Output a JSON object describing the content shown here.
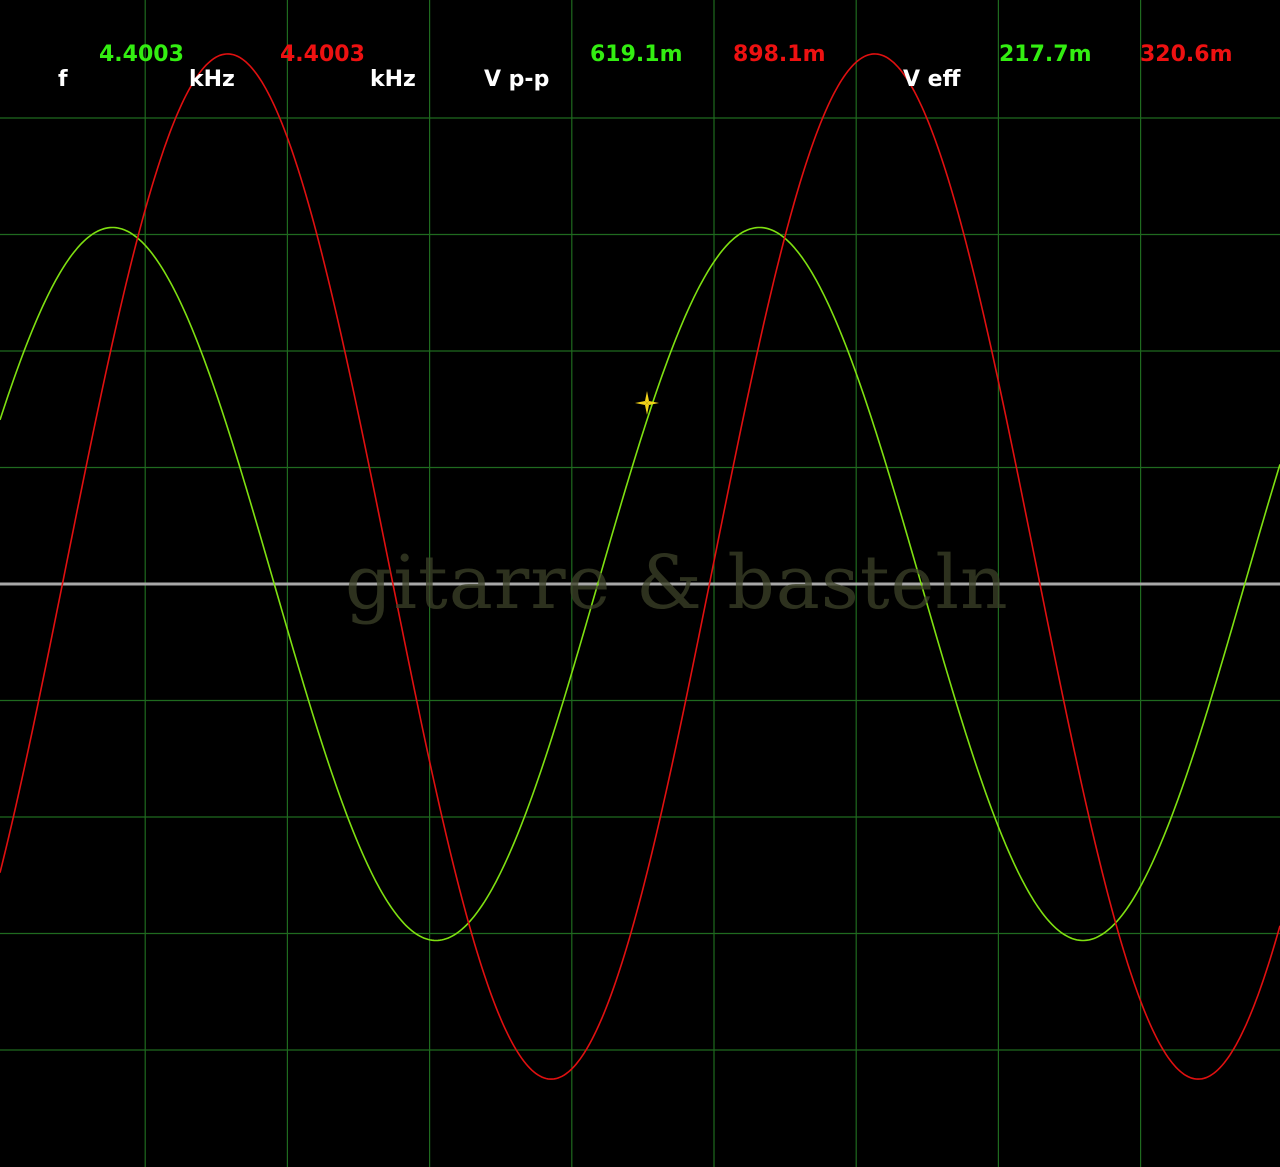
{
  "colors": {
    "background": "#000000",
    "grid": "#1f6a1f",
    "centerline": "#a8a8a8",
    "channel1": "#7fe011",
    "channel2": "#e01010",
    "cursor": "#f2d21a",
    "label_text": "#ffffff",
    "ch1_text": "#33ee11",
    "ch2_text": "#ee1111"
  },
  "readouts": {
    "frequency": {
      "label": "f",
      "ch1_value": "4.4003",
      "ch1_unit": "kHz",
      "ch2_value": "4.4003",
      "ch2_unit": "kHz"
    },
    "vpp": {
      "label": "V p-p",
      "ch1_value": "619.1m",
      "ch2_value": "898.1m"
    },
    "veff": {
      "label": "V eff",
      "ch1_value": "217.7m",
      "ch2_value": "320.6m"
    }
  },
  "watermark": "gitarre & basteln",
  "cursor_icon": "crosshair-cursor-icon",
  "chart_data": {
    "type": "line",
    "grid": true,
    "grid_divisions": {
      "x": 9,
      "y": 10
    },
    "x_range_divisions": [
      0,
      9
    ],
    "y_range_divisions": [
      -5,
      5
    ],
    "series": [
      {
        "name": "",
        "color": "#7fe011",
        "waveform": "sine",
        "amplitude_divisions": 3.06,
        "offset_divisions": 0.0,
        "period_divisions": 4.55,
        "peak_at_divisions": 0.77
      },
      {
        "name": "",
        "color": "#e01010",
        "waveform": "sine",
        "amplitude_divisions": 4.4,
        "offset_divisions": 0.15,
        "period_divisions": 4.55,
        "peak_at_divisions": 1.58
      }
    ]
  }
}
